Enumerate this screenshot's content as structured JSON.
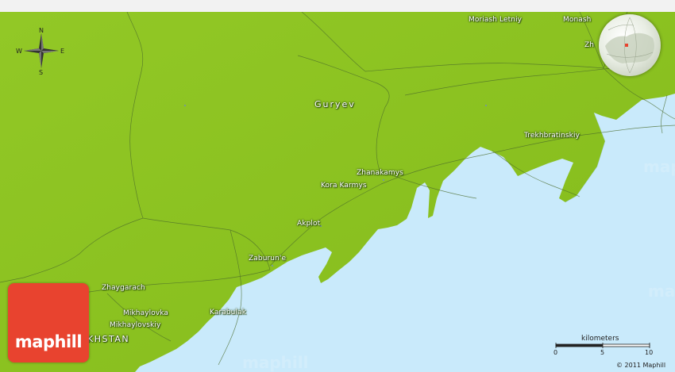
{
  "places": [
    {
      "id": "guryev",
      "name": "Guryev"
    },
    {
      "id": "moriash-letniy",
      "name": "Moriash Letniy"
    },
    {
      "id": "monash",
      "name": "Monash"
    },
    {
      "id": "zh-cut",
      "name": "Zh"
    },
    {
      "id": "trekhbratinskiy",
      "name": "Trekhbratinskiy"
    },
    {
      "id": "zhanakamys",
      "name": "Zhanakamys"
    },
    {
      "id": "kora-karmys",
      "name": "Kora Karmys"
    },
    {
      "id": "akplot",
      "name": "Akplot"
    },
    {
      "id": "zaburunie",
      "name": "Zaburun'e"
    },
    {
      "id": "zhaygarach",
      "name": "Zhaygarach"
    },
    {
      "id": "mikhaylovka",
      "name": "Mikhaylovka"
    },
    {
      "id": "mikhaylovskiy",
      "name": "Mikhaylovskiy"
    },
    {
      "id": "karabulak",
      "name": "Karabulak"
    }
  ],
  "country_label": "KHSTAN",
  "compass": {
    "n": "N",
    "s": "S",
    "e": "E",
    "w": "W"
  },
  "scale": {
    "title": "kilometers",
    "ticks": [
      "0",
      "5",
      "10"
    ]
  },
  "logo": {
    "text": "maphill"
  },
  "copyright": "© 2011 Maphill",
  "colors": {
    "land": "#8cc31f",
    "water": "#c9eafb",
    "logo": "#e8432f"
  }
}
